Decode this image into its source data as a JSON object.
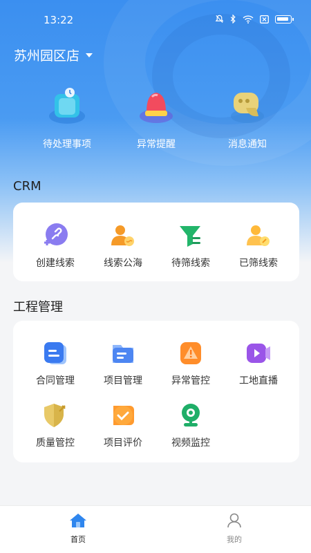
{
  "status": {
    "time": "13:22"
  },
  "store": {
    "name": "苏州园区店"
  },
  "quick": [
    {
      "label": "待处理事项",
      "icon": "todo-clipboard-icon"
    },
    {
      "label": "异常提醒",
      "icon": "alarm-siren-icon"
    },
    {
      "label": "消息通知",
      "icon": "message-bubble-icon"
    }
  ],
  "crm": {
    "title": "CRM",
    "items": [
      {
        "label": "创建线索",
        "icon": "create-lead-icon"
      },
      {
        "label": "线索公海",
        "icon": "lead-pool-icon"
      },
      {
        "label": "待筛线索",
        "icon": "pending-filter-icon"
      },
      {
        "label": "已筛线索",
        "icon": "filtered-lead-icon"
      }
    ]
  },
  "engineering": {
    "title": "工程管理",
    "items": [
      {
        "label": "合同管理",
        "icon": "contract-icon"
      },
      {
        "label": "项目管理",
        "icon": "project-folder-icon"
      },
      {
        "label": "异常管控",
        "icon": "warning-icon"
      },
      {
        "label": "工地直播",
        "icon": "live-video-icon"
      },
      {
        "label": "质量管控",
        "icon": "quality-shield-icon"
      },
      {
        "label": "项目评价",
        "icon": "evaluation-check-icon"
      },
      {
        "label": "视频监控",
        "icon": "camera-icon"
      }
    ]
  },
  "tabs": [
    {
      "label": "首页",
      "active": true
    },
    {
      "label": "我的",
      "active": false
    }
  ],
  "colors": {
    "primary": "#2f86ee",
    "hero": "#3b8ff0",
    "inactive": "#888888"
  }
}
